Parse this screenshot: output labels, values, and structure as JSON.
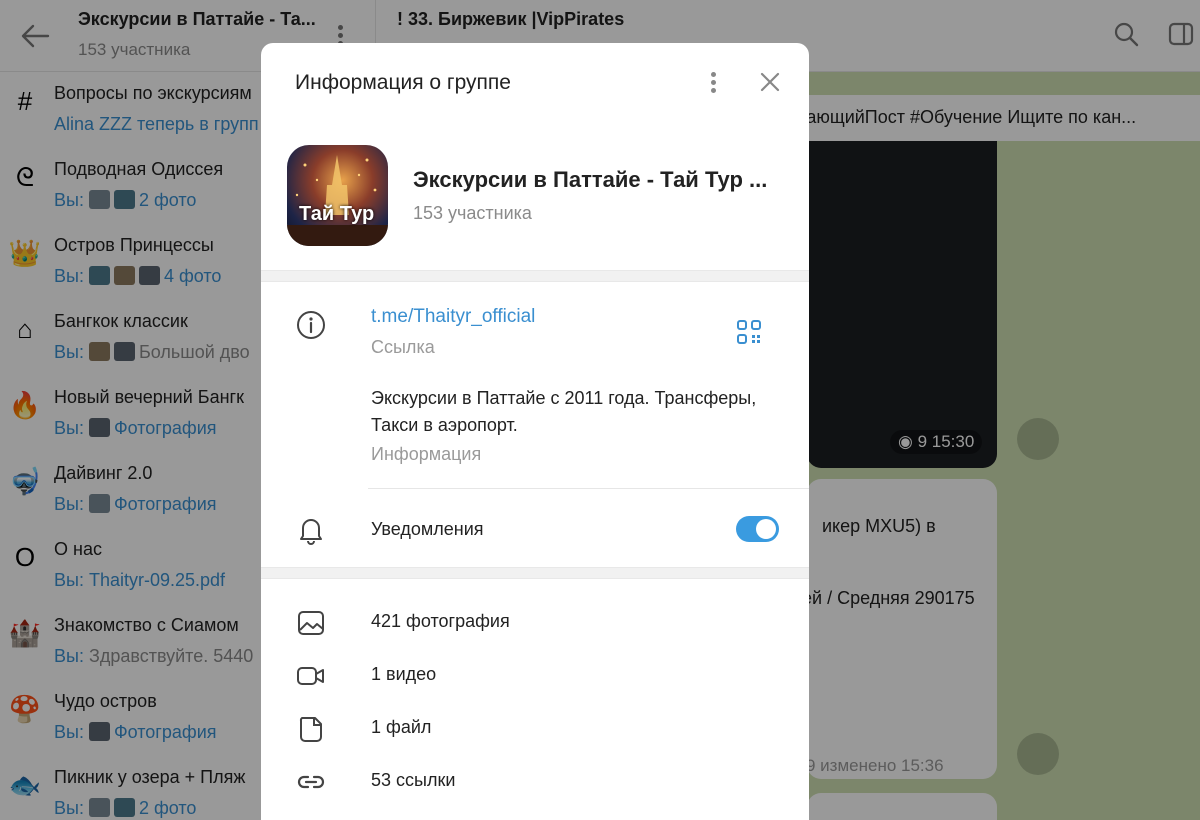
{
  "sidebar": {
    "title": "Экскурсии в Паттайе - Та...",
    "members": "153 участника",
    "topics": [
      {
        "icon": "#",
        "title": "Вопросы по экскурсиям",
        "sub_prefix": "",
        "sub": "Alina ZZZ теперь в групп",
        "thumbs": 0
      },
      {
        "icon": "ᘓ",
        "title": "Подводная Одиссея",
        "sub_prefix": "Вы: ",
        "sub": "2 фото",
        "thumbs": 2
      },
      {
        "icon": "👑",
        "title": "Остров Принцессы",
        "sub_prefix": "Вы: ",
        "sub": "4 фото",
        "thumbs": 3
      },
      {
        "icon": "⌂",
        "title": "Бангкок классик",
        "sub_prefix": "Вы: ",
        "sub": "Большой дво",
        "thumbs": 2,
        "gray": true
      },
      {
        "icon": "🔥",
        "title": "Новый вечерний Бангк",
        "sub_prefix": "Вы: ",
        "sub": "Фотография",
        "thumbs": 1
      },
      {
        "icon": "🤿",
        "title": "Дайвинг 2.0",
        "sub_prefix": "Вы: ",
        "sub": "Фотография",
        "thumbs": 1
      },
      {
        "icon": "O",
        "title": "О нас",
        "sub_prefix": "Вы: ",
        "sub": "Thaityr-09.25.pdf",
        "thumbs": 0
      },
      {
        "icon": "🏰",
        "title": "Знакомство с Сиамом",
        "sub_prefix": "Вы: ",
        "sub": "Здравствуйте. 5440",
        "thumbs": 0,
        "gray": true
      },
      {
        "icon": "🍄",
        "title": "Чудо остров",
        "sub_prefix": "Вы: ",
        "sub": "Фотография",
        "thumbs": 1
      },
      {
        "icon": "🐟",
        "title": "Пикник у озера + Пляж",
        "sub_prefix": "Вы: ",
        "sub": "2 фото",
        "thumbs": 2
      }
    ]
  },
  "chat": {
    "title": "! 33. Биржевик |VipPirates",
    "pinned": "чающийПост #Обучение  Ищите по кан...",
    "views1": "9  15:30",
    "msg_line1": "икер MXU5) в",
    "msg_line2": "ей / Средняя 290175",
    "msg_meta": "9   изменено 15:36"
  },
  "modal": {
    "title": "Информация о группе",
    "group_name": "Экскурсии в Паттайе - Тай Тур ...",
    "members": "153 участника",
    "avatar_text": "Тай Тур",
    "link": "t.me/Thaityr_official",
    "link_label": "Ссылка",
    "description": "Экскурсии в Паттайе с 2011 года. Трансферы, Такси в аэропорт.",
    "description_label": "Информация",
    "notifications_label": "Уведомления",
    "notifications_on": true,
    "stats": {
      "photos": "421 фотография",
      "videos": "1 видео",
      "files": "1 файл",
      "links": "53 ссылки"
    }
  },
  "colors": {
    "accent": "#3a8fd0",
    "toggle": "#3a9be0",
    "chat_bg": "#cfe0b3"
  }
}
